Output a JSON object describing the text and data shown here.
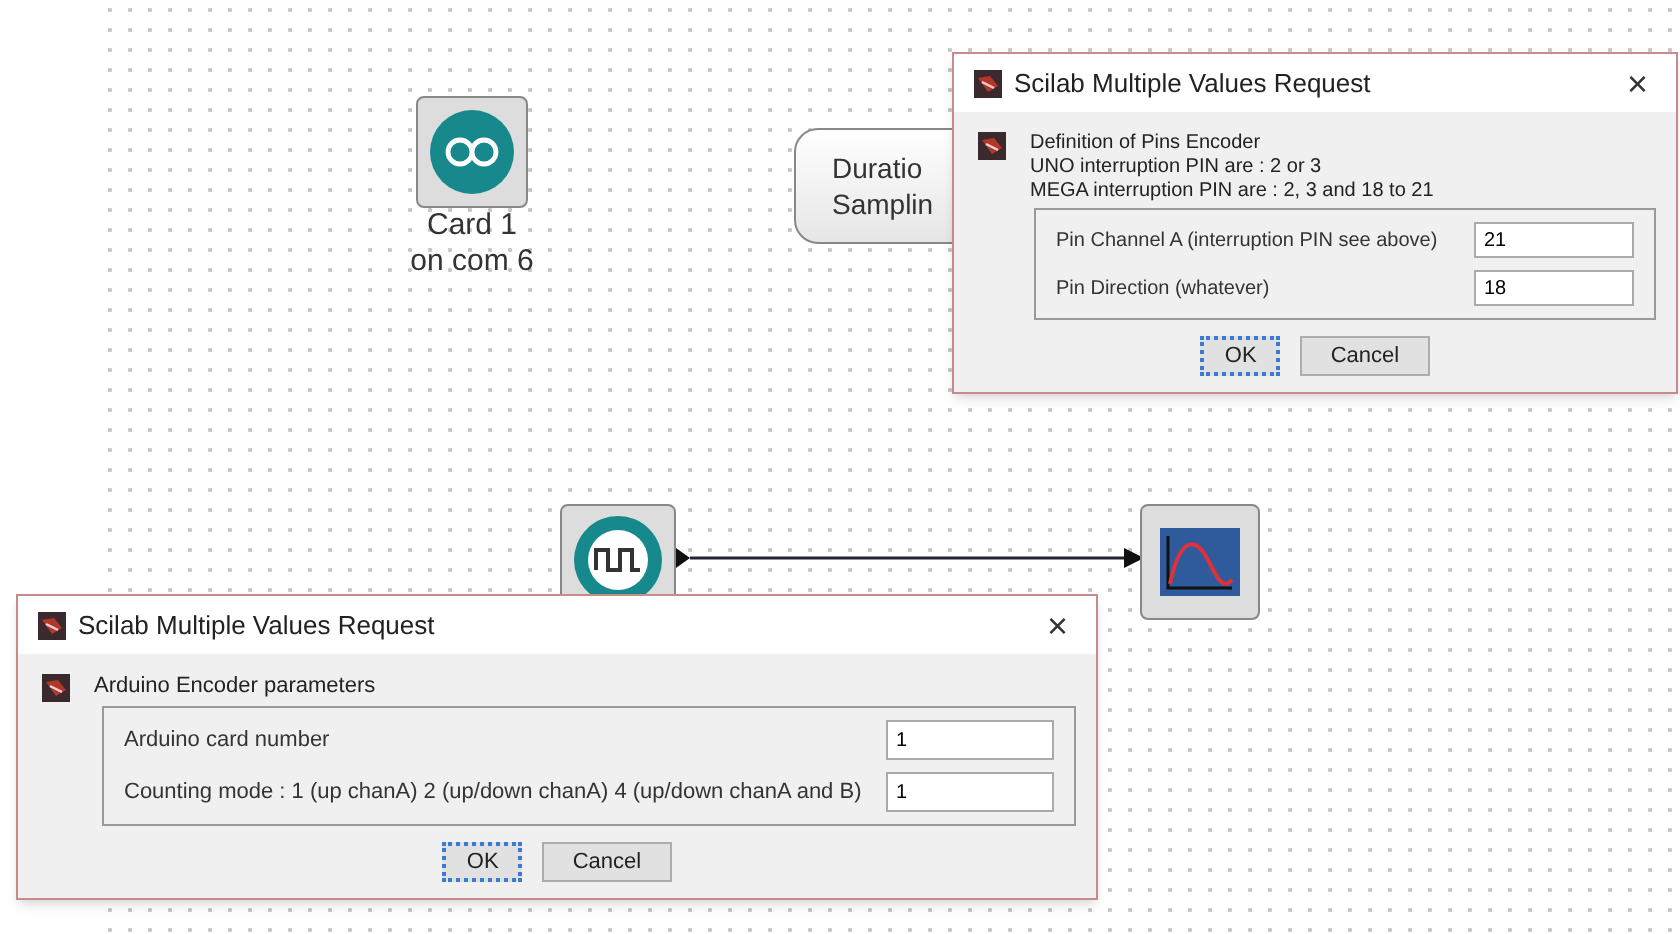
{
  "canvas": {
    "card_block": {
      "lines": [
        "Card 1",
        "on com 6"
      ]
    },
    "text_block": {
      "lines": [
        "Duratio",
        "Samplin"
      ]
    },
    "link": {
      "kind": "arrow"
    }
  },
  "dialogs": [
    {
      "title": "Scilab Multiple Values Request",
      "close": "×",
      "message": [
        "Definition of Pins Encoder",
        "UNO interruption PIN are : 2 or 3",
        "MEGA interruption PIN are : 2, 3 and 18 to 21"
      ],
      "fields": [
        {
          "label": "Pin Channel A (interruption PIN see above)",
          "value": "21"
        },
        {
          "label": "Pin Direction (whatever)",
          "value": "18"
        }
      ],
      "buttons": [
        {
          "label": "OK",
          "focused": true
        },
        {
          "label": "Cancel",
          "focused": false
        }
      ]
    },
    {
      "title": "Scilab Multiple Values Request",
      "close": "×",
      "message": [
        "Arduino Encoder parameters"
      ],
      "fields": [
        {
          "label": "Arduino card number",
          "value": "1"
        },
        {
          "label": "Counting mode : 1 (up chanA) 2 (up/down chanA) 4 (up/down chanA and B)",
          "value": "1"
        }
      ],
      "buttons": [
        {
          "label": "OK",
          "focused": true
        },
        {
          "label": "Cancel",
          "focused": false
        }
      ]
    }
  ]
}
